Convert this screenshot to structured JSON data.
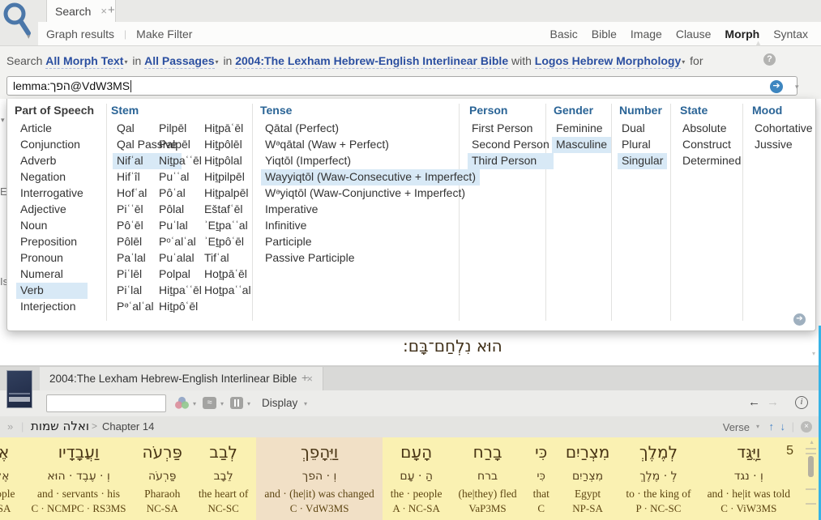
{
  "icons": {
    "caret": "▾",
    "up_pointer": "▲",
    "close": "×",
    "new_tab": "+",
    "pipe": "|",
    "help": "?",
    "go_arrow": "➔",
    "back": "←",
    "forward": "→",
    "info": "i",
    "guillemet": "»",
    "crumb_arrow": ">",
    "arrow_up": "↑",
    "arrow_down": "↓",
    "circle_close": "×",
    "approx": "≈",
    "scroll_down": "▾"
  },
  "search_panel": {
    "tab_label": "Search",
    "graph_results": "Graph results",
    "make_filter": "Make Filter",
    "types": [
      {
        "label": "Basic"
      },
      {
        "label": "Bible"
      },
      {
        "label": "Image"
      },
      {
        "label": "Clause"
      },
      {
        "label": "Morph",
        "selected": true
      },
      {
        "label": "Syntax"
      }
    ],
    "criteria": {
      "search_word": "Search",
      "scope": "All Morph Text",
      "in1": "in",
      "passages": "All Passages",
      "in2": "in",
      "resource": "2004:The Lexham Hebrew-English Interlinear Bible",
      "with_word": "with",
      "morphology": "Logos Hebrew Morphology",
      "for_word": "for"
    },
    "query": "lemma:הפך@VdW3MS",
    "fragments": [
      "▾",
      "E",
      "Is"
    ]
  },
  "morph_picker": {
    "part_of_speech": {
      "title": "Part of Speech",
      "items": [
        {
          "label": "Article"
        },
        {
          "label": "Conjunction"
        },
        {
          "label": "Adverb"
        },
        {
          "label": "Negation"
        },
        {
          "label": "Interrogative"
        },
        {
          "label": "Adjective"
        },
        {
          "label": "Noun"
        },
        {
          "label": "Preposition"
        },
        {
          "label": "Pronoun"
        },
        {
          "label": "Numeral"
        },
        {
          "label": "Verb",
          "selected": true
        },
        {
          "label": "Interjection"
        }
      ]
    },
    "stem": {
      "title": "Stem",
      "col1": [
        {
          "label": "Qal"
        },
        {
          "label": "Qal Passive"
        },
        {
          "label": "Nifʿal",
          "selected": true
        },
        {
          "label": "Hifʿîl"
        },
        {
          "label": "Hofʿal"
        },
        {
          "label": "Piʿʿēl"
        },
        {
          "label": "Pôʿēl"
        },
        {
          "label": "Pôlēl"
        },
        {
          "label": "Paʿlal"
        },
        {
          "label": "Piʿlēl"
        },
        {
          "label": "Piʿlal"
        },
        {
          "label": "Pᵊʿalʿal"
        }
      ],
      "col2": [
        {
          "label": "Pilpēl"
        },
        {
          "label": "Palpēl"
        },
        {
          "label": "Niṯpaʿʿēl"
        },
        {
          "label": "Puʿʿal"
        },
        {
          "label": "Pôʿal"
        },
        {
          "label": "Pôlal"
        },
        {
          "label": "Puʿlal"
        },
        {
          "label": "Pᵒʿalʿal"
        },
        {
          "label": "Puʿalal"
        },
        {
          "label": "Polpal"
        },
        {
          "label": "Hiṯpaʿʿēl"
        },
        {
          "label": "Hiṯpôʿēl"
        }
      ],
      "col3": [
        {
          "label": "Hiṯpāʿēl"
        },
        {
          "label": "Hiṯpôlēl"
        },
        {
          "label": "Hiṯpôlal"
        },
        {
          "label": "Hiṯpilpēl"
        },
        {
          "label": "Hiṯpalpēl"
        },
        {
          "label": "Eštafʿēl"
        },
        {
          "label": "ʾEṯpaʿʿal"
        },
        {
          "label": "ʾEṯpôʿēl"
        },
        {
          "label": "Tifʿal"
        },
        {
          "label": "Hoṯpāʿēl"
        },
        {
          "label": "Hoṯpaʿʿal"
        }
      ]
    },
    "tense": {
      "title": "Tense",
      "items": [
        {
          "label": "Qātal (Perfect)"
        },
        {
          "label": "Wᵊqātal (Waw + Perfect)"
        },
        {
          "label": "Yiqtōl (Imperfect)"
        },
        {
          "label": "Wayyiqtōl (Waw-Consecutive + Imperfect)",
          "selected": true
        },
        {
          "label": "Wᵊyiqtōl (Waw-Conjunctive + Imperfect)"
        },
        {
          "label": "Imperative"
        },
        {
          "label": "Infinitive"
        },
        {
          "label": "Participle"
        },
        {
          "label": "Passive Participle"
        }
      ]
    },
    "person": {
      "title": "Person",
      "items": [
        {
          "label": "First Person"
        },
        {
          "label": "Second Person"
        },
        {
          "label": "Third Person",
          "selected": true
        }
      ]
    },
    "gender": {
      "title": "Gender",
      "items": [
        {
          "label": "Feminine"
        },
        {
          "label": "Masculine",
          "selected": true
        }
      ]
    },
    "number": {
      "title": "Number",
      "items": [
        {
          "label": "Dual"
        },
        {
          "label": "Plural"
        },
        {
          "label": "Singular",
          "selected": true
        }
      ]
    },
    "state": {
      "title": "State",
      "items": [
        {
          "label": "Absolute"
        },
        {
          "label": "Construct"
        },
        {
          "label": "Determined"
        }
      ]
    },
    "mood": {
      "title": "Mood",
      "items": [
        {
          "label": "Cohortative"
        },
        {
          "label": "Jussive"
        }
      ]
    }
  },
  "results_preview": {
    "hebrew": "הוּא נִלְחַם־בָּם:"
  },
  "bottom_panel": {
    "tab_label": "2004:The Lexham Hebrew-English Interlinear Bible",
    "display_label": "Display",
    "breadcrumb": {
      "book": "ואלה שמות",
      "chapter": "Chapter 14"
    },
    "verse_nav_label": "Verse",
    "verse_number": "5",
    "words": [
      {
        "surface": "וַיֻּגַּד",
        "lexeme": "וְ · נגד",
        "gloss": "and · he|it was told",
        "morph": "C · ViW3MS"
      },
      {
        "surface": "לְמֶלֶךְ",
        "lexeme": "לְ · מֶלֶךְ",
        "gloss": "to · the king of",
        "morph": "P · NC-SC"
      },
      {
        "surface": "מִצְרַיִם",
        "lexeme": "מִצְרַיִם",
        "gloss": "Egypt",
        "morph": "NP-SA"
      },
      {
        "surface": "כִּי",
        "lexeme": "כִּי",
        "gloss": "that",
        "morph": "C"
      },
      {
        "surface": "בָרַח",
        "lexeme": "ברח",
        "gloss": "(he|they) fled",
        "morph": "VaP3MS"
      },
      {
        "surface": "הָעָם",
        "lexeme": "הַ · עָם",
        "gloss": "the · people",
        "morph": "A · NC-SA"
      },
      {
        "surface": "וַיֵּהָפֵךְ",
        "lexeme": "וְ · הפך",
        "gloss": "and · (he|it) was changed",
        "morph": "C · VdW3MS",
        "selected": true
      },
      {
        "surface": "לְבַב",
        "lexeme": "לֵבָב",
        "gloss": "the heart of",
        "morph": "NC-SC"
      },
      {
        "surface": "פַּרְעֹה",
        "lexeme": "פַּרְעֹה",
        "gloss": "Pharaoh",
        "morph": "NC-SA"
      },
      {
        "surface": "וַעֲבָדָיו",
        "lexeme": "וְ · עֶבֶד · הוּא",
        "gloss": "and · servants · his",
        "morph": "C · NCMPC · RS3MS"
      },
      {
        "surface": "אֶל־הָעָם",
        "lexeme": "אֶל · הַ · עָם",
        "gloss": "to · the · people",
        "morph": "P · A · NC-SA"
      }
    ]
  }
}
